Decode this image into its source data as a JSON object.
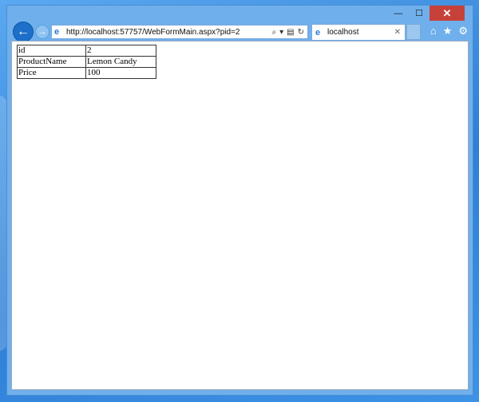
{
  "window": {
    "minimize_glyph": "—",
    "maximize_glyph": "☐",
    "close_glyph": "✕"
  },
  "nav": {
    "back_glyph": "←",
    "forward_glyph": "→",
    "address": "http://localhost:57757/WebFormMain.aspx?pid=2",
    "search_glyph": "⌕",
    "dropdown_glyph": "▾",
    "compat_glyph": "▤",
    "refresh_glyph": "↻"
  },
  "tab": {
    "title": "localhost",
    "close_glyph": "✕"
  },
  "tools": {
    "home_glyph": "⌂",
    "favorites_glyph": "★",
    "settings_glyph": "⚙"
  },
  "table": {
    "rows": [
      {
        "key": "id",
        "value": "2"
      },
      {
        "key": "ProductName",
        "value": "Lemon Candy"
      },
      {
        "key": "Price",
        "value": "100"
      }
    ]
  }
}
